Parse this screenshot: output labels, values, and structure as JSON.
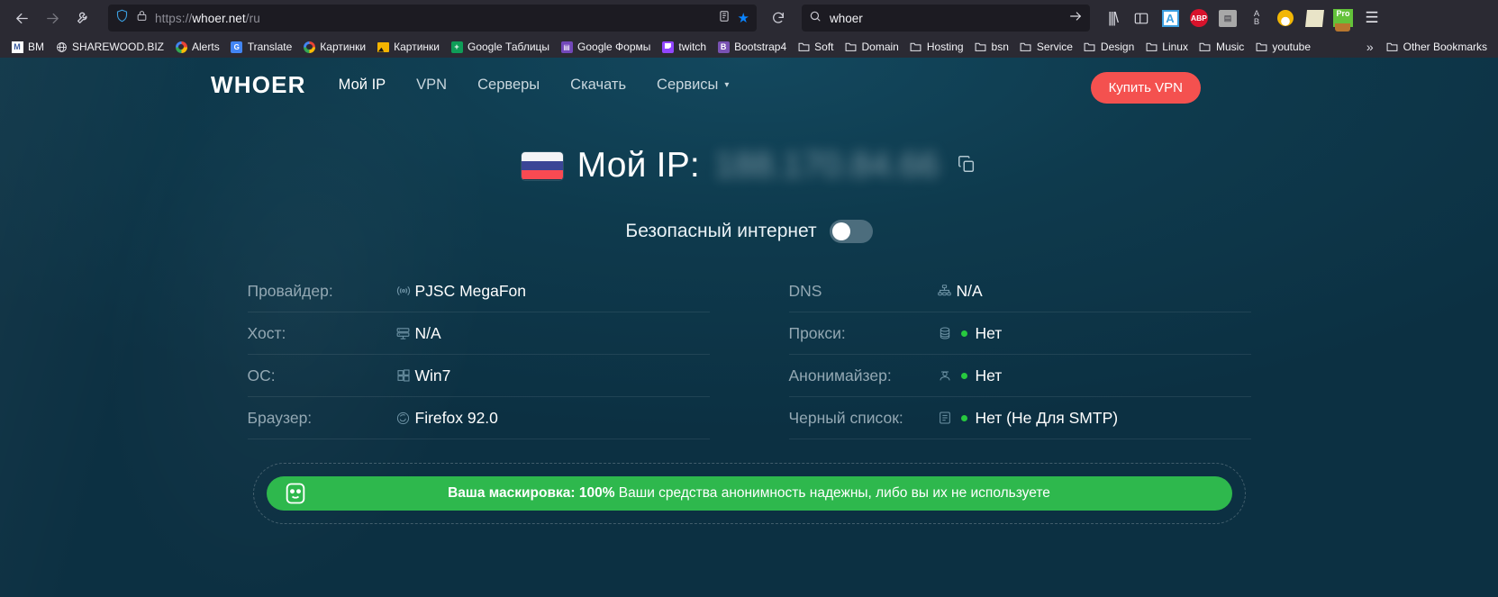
{
  "browser": {
    "back_icon": "back-arrow-icon",
    "forward_icon": "forward-arrow-icon",
    "tools_icon": "wrench-icon",
    "url": "https://whoer.net/ru",
    "url_scheme": "https://",
    "url_host": "whoer.net",
    "url_path": "/ru",
    "search_value": "whoer",
    "reload_icon": "reload-icon",
    "shield_icon": "shield-icon",
    "lock_icon": "lock-icon",
    "reader_icon": "reader-view-icon",
    "bookmark_star_icon": "star-icon",
    "extensions": [
      {
        "name": "library-icon",
        "label": "|||\\"
      },
      {
        "name": "sidebar-icon",
        "label": ""
      },
      {
        "name": "translate-extension-icon",
        "label": "A"
      },
      {
        "name": "adblock-plus-icon",
        "label": "ABP"
      },
      {
        "name": "notes-extension-icon",
        "label": ""
      },
      {
        "name": "ab-test-icon",
        "label": "A\\nB"
      },
      {
        "name": "flame-extension-icon",
        "label": ""
      },
      {
        "name": "highlight-extension-icon",
        "label": ""
      },
      {
        "name": "pro-extension-icon",
        "label": "Pro"
      }
    ],
    "menu_icon": "hamburger-menu-icon",
    "bookmarks": [
      {
        "label": "BM",
        "icon": "bm-icon"
      },
      {
        "label": "SHAREWOOD.BIZ",
        "icon": "globe-icon"
      },
      {
        "label": "Alerts",
        "icon": "google-icon"
      },
      {
        "label": "Translate",
        "icon": "google-translate-icon"
      },
      {
        "label": "Картинки",
        "icon": "google-icon"
      },
      {
        "label": "Картинки",
        "icon": "picture-icon"
      },
      {
        "label": "Google Таблицы",
        "icon": "google-sheets-icon"
      },
      {
        "label": "Google Формы",
        "icon": "google-forms-icon"
      },
      {
        "label": "twitch",
        "icon": "twitch-icon"
      },
      {
        "label": "Bootstrap4",
        "icon": "bootstrap-icon"
      },
      {
        "label": "Soft",
        "icon": "folder-icon"
      },
      {
        "label": "Domain",
        "icon": "folder-icon"
      },
      {
        "label": "Hosting",
        "icon": "folder-icon"
      },
      {
        "label": "bsn",
        "icon": "folder-icon"
      },
      {
        "label": "Service",
        "icon": "folder-icon"
      },
      {
        "label": "Design",
        "icon": "folder-icon"
      },
      {
        "label": "Linux",
        "icon": "folder-icon"
      },
      {
        "label": "Music",
        "icon": "folder-icon"
      },
      {
        "label": "youtube",
        "icon": "folder-icon"
      }
    ],
    "overflow_label": "»",
    "other_bookmarks_label": "Other Bookmarks"
  },
  "site": {
    "logo": "WHOER",
    "nav": [
      {
        "label": "Мой IP",
        "active": true
      },
      {
        "label": "VPN",
        "active": false
      },
      {
        "label": "Серверы",
        "active": false
      },
      {
        "label": "Скачать",
        "active": false
      },
      {
        "label": "Сервисы",
        "active": false,
        "has_caret": true
      }
    ],
    "buy_button": "Купить VPN",
    "ip_heading": "Мой IP:",
    "ip_value": "188.170.84.66",
    "flag": "russia-flag",
    "copy_icon": "copy-icon",
    "toggle_label": "Безопасный интернет",
    "toggle_state": "off",
    "left_column": [
      {
        "key": "Провайдер:",
        "icon": "broadcast-icon",
        "value": "PJSC MegaFon",
        "dot": false
      },
      {
        "key": "Хост:",
        "icon": "server-icon",
        "value": "N/A",
        "dot": false
      },
      {
        "key": "ОС:",
        "icon": "windows-icon",
        "value": "Win7",
        "dot": false
      },
      {
        "key": "Браузер:",
        "icon": "firefox-icon",
        "value": "Firefox 92.0",
        "dot": false
      }
    ],
    "right_column": [
      {
        "key": "DNS",
        "icon": "dns-network-icon",
        "value": "N/A",
        "dot": false
      },
      {
        "key": "Прокси:",
        "icon": "database-icon",
        "value": "Нет",
        "dot": true
      },
      {
        "key": "Анонимайзер:",
        "icon": "spy-icon",
        "value": "Нет",
        "dot": true
      },
      {
        "key": "Черный список:",
        "icon": "checklist-icon",
        "value": "Нет (Не Для SMTP)",
        "dot": true
      }
    ],
    "banner": {
      "icon": "smiley-mask-icon",
      "bold_text": "Ваша маскировка: 100%",
      "text": " Ваши средства анонимность надежны, либо вы их не используете"
    },
    "colors": {
      "accent_red": "#f4514f",
      "banner_green": "#2eb84d",
      "status_dot_green": "#27c93f",
      "page_bg": "#0c3042",
      "chrome_bg": "#2b2a33"
    }
  }
}
